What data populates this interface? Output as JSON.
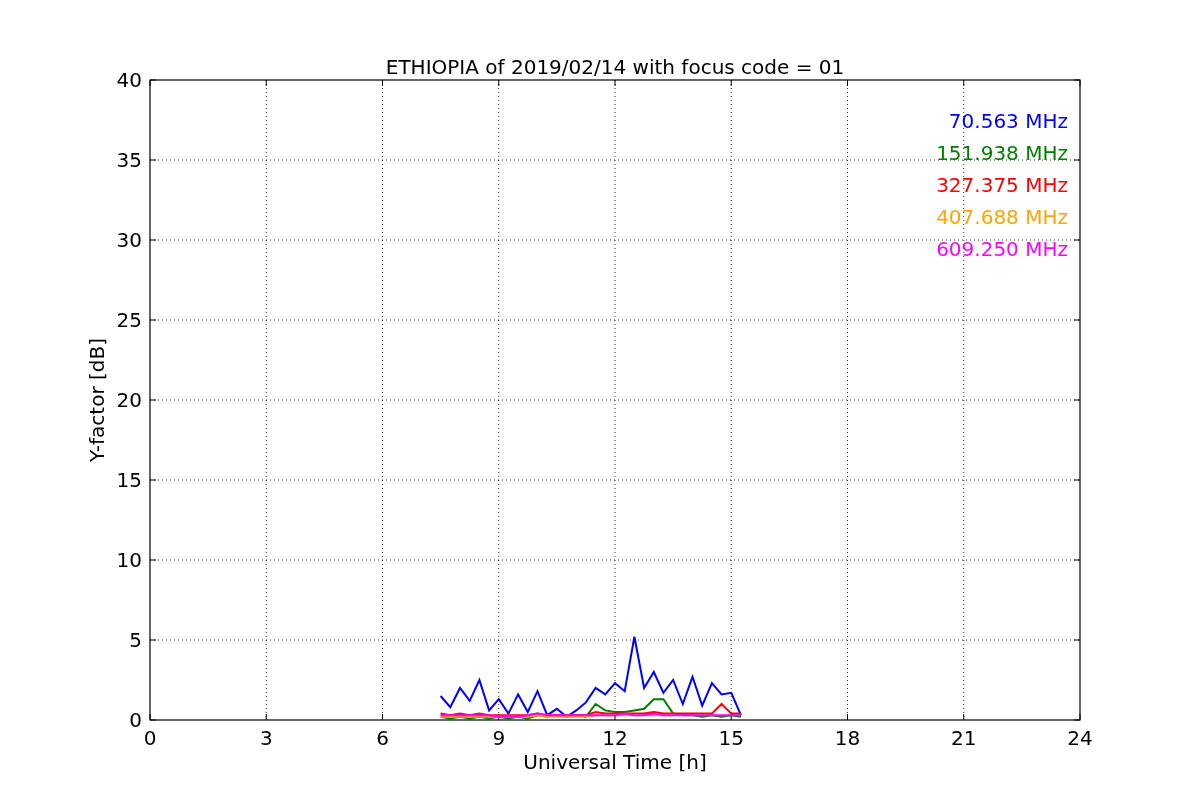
{
  "chart_data": {
    "type": "line",
    "title": "ETHIOPIA of 2019/02/14 with focus code = 01",
    "xlabel": "Universal Time [h]",
    "ylabel": "Y-factor [dB]",
    "x": [
      7.5,
      7.75,
      8,
      8.25,
      8.5,
      8.75,
      9,
      9.25,
      9.5,
      9.75,
      10,
      10.25,
      10.5,
      10.75,
      11,
      11.25,
      11.5,
      11.75,
      12,
      12.25,
      12.5,
      12.75,
      13,
      13.25,
      13.5,
      13.75,
      14,
      14.25,
      14.5,
      14.75,
      15,
      15.25
    ],
    "series": [
      {
        "name": "70.563 MHz",
        "color": "#0000ff",
        "values": [
          1.5,
          0.8,
          2.0,
          1.2,
          2.5,
          0.6,
          1.3,
          0.4,
          1.6,
          0.5,
          1.8,
          0.3,
          0.7,
          0.2,
          0.6,
          1.1,
          2.0,
          1.6,
          2.3,
          1.8,
          5.2,
          2.0,
          3.0,
          1.7,
          2.5,
          1.0,
          2.7,
          0.9,
          2.3,
          1.6,
          1.7,
          0.3
        ]
      },
      {
        "name": "151.938 MHz",
        "color": "#008000",
        "values": [
          0.2,
          0.1,
          0.2,
          0.1,
          0.2,
          0.1,
          0.2,
          0.1,
          0.2,
          0.1,
          0.3,
          0.2,
          0.3,
          0.2,
          0.3,
          0.2,
          1.0,
          0.6,
          0.5,
          0.5,
          0.6,
          0.7,
          1.3,
          1.3,
          0.4,
          0.3,
          0.3,
          0.2,
          0.3,
          0.2,
          0.3,
          0.2
        ]
      },
      {
        "name": "327.375 MHz",
        "color": "#ff0000",
        "values": [
          0.4,
          0.3,
          0.4,
          0.3,
          0.4,
          0.3,
          0.3,
          0.3,
          0.3,
          0.3,
          0.4,
          0.3,
          0.3,
          0.3,
          0.3,
          0.3,
          0.5,
          0.4,
          0.4,
          0.4,
          0.4,
          0.4,
          0.5,
          0.4,
          0.4,
          0.4,
          0.4,
          0.4,
          0.4,
          1.0,
          0.4,
          0.4
        ]
      },
      {
        "name": "407.688 MHz",
        "color": "#ffa500",
        "values": [
          0.2,
          0.2,
          0.2,
          0.2,
          0.2,
          0.2,
          0.2,
          0.2,
          0.2,
          0.2,
          0.3,
          0.2,
          0.2,
          0.2,
          0.2,
          0.2,
          0.3,
          0.3,
          0.3,
          0.3,
          0.3,
          0.3,
          0.3,
          0.3,
          0.3,
          null,
          null,
          null,
          null,
          null,
          null,
          null
        ]
      },
      {
        "name": "609.250 MHz",
        "color": "#ff00ff",
        "values": [
          0.3,
          0.3,
          0.3,
          0.3,
          0.3,
          0.3,
          0.2,
          0.2,
          0.2,
          0.3,
          0.4,
          0.3,
          0.3,
          0.3,
          0.3,
          0.3,
          0.3,
          0.3,
          0.3,
          0.4,
          0.3,
          0.3,
          0.4,
          0.3,
          0.3,
          0.3,
          0.3,
          0.3,
          0.3,
          0.3,
          0.3,
          0.3
        ]
      }
    ],
    "grid": true,
    "xlim": [
      0,
      24
    ],
    "ylim": [
      0,
      40
    ],
    "xticks": [
      0,
      3,
      6,
      9,
      12,
      15,
      18,
      21,
      24
    ],
    "yticks": [
      0,
      5,
      10,
      15,
      20,
      25,
      30,
      35,
      40
    ]
  }
}
